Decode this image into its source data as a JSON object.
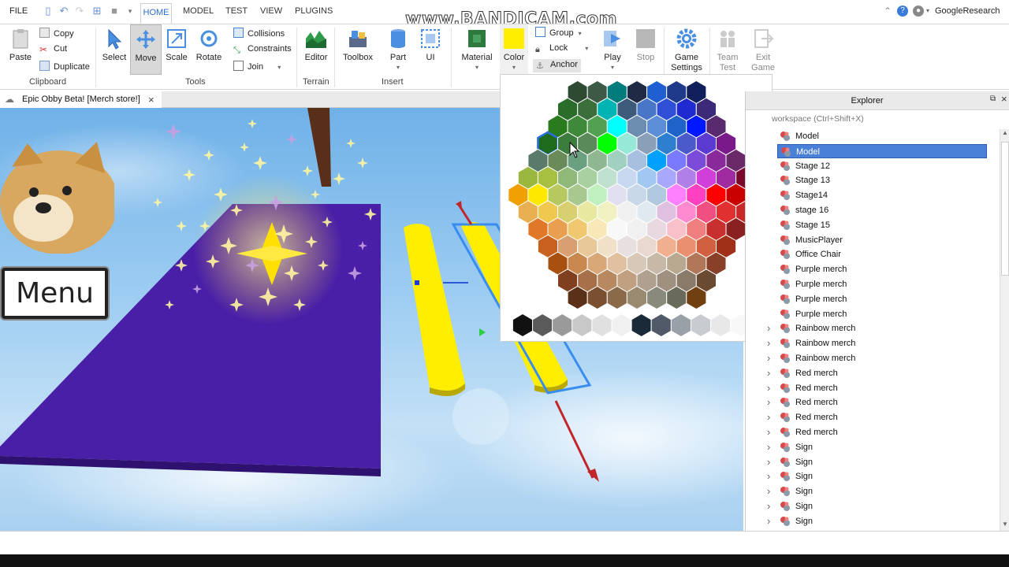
{
  "menu": {
    "file": "FILE",
    "tabs": [
      "HOME",
      "MODEL",
      "TEST",
      "VIEW",
      "PLUGINS"
    ],
    "watermark": "www.BANDICAM.com",
    "user": "GoogleResearch"
  },
  "ribbon": {
    "clipboard": {
      "paste": "Paste",
      "copy": "Copy",
      "cut": "Cut",
      "duplicate": "Duplicate",
      "label": "Clipboard"
    },
    "tools": {
      "select": "Select",
      "move": "Move",
      "scale": "Scale",
      "rotate": "Rotate",
      "collisions": "Collisions",
      "constraints": "Constraints",
      "join": "Join",
      "label": "Tools"
    },
    "terrain": {
      "editor": "Editor",
      "label": "Terrain"
    },
    "insert": {
      "toolbox": "Toolbox",
      "part": "Part",
      "ui": "UI",
      "label": "Insert"
    },
    "edit": {
      "material": "Material",
      "color": "Color",
      "group": "Group",
      "lock": "Lock",
      "anchor": "Anchor"
    },
    "test": {
      "play": "Play",
      "stop": "Stop"
    },
    "settings": {
      "game_settings_1": "Game",
      "game_settings_2": "Settings"
    },
    "team_test": {
      "line1": "Team",
      "line2": "Test"
    },
    "exit_game": {
      "line1": "Exit",
      "line2": "Game"
    },
    "accent_color": "#2a6fc9"
  },
  "document_tab": {
    "title": "Epic Obby Beta! [Merch store!]"
  },
  "viewport": {
    "menu_button": "Menu"
  },
  "explorer": {
    "title": "Explorer",
    "filter_placeholder": "workspace (Ctrl+Shift+X)",
    "items": [
      {
        "label": "Model",
        "expandable": false,
        "selected": false
      },
      {
        "label": "Model",
        "expandable": false,
        "selected": true
      },
      {
        "label": "Stage 12",
        "expandable": false,
        "selected": false
      },
      {
        "label": "Stage 13",
        "expandable": false,
        "selected": false
      },
      {
        "label": "Stage14",
        "expandable": false,
        "selected": false
      },
      {
        "label": "stage 16",
        "expandable": false,
        "selected": false
      },
      {
        "label": "Stage 15",
        "expandable": false,
        "selected": false
      },
      {
        "label": "MusicPlayer",
        "expandable": false,
        "selected": false
      },
      {
        "label": "Office Chair",
        "expandable": false,
        "selected": false
      },
      {
        "label": "Purple merch",
        "expandable": false,
        "selected": false
      },
      {
        "label": "Purple merch",
        "expandable": false,
        "selected": false
      },
      {
        "label": "Purple merch",
        "expandable": false,
        "selected": false
      },
      {
        "label": "Purple merch",
        "expandable": false,
        "selected": false
      },
      {
        "label": "Rainbow merch",
        "expandable": true,
        "selected": false
      },
      {
        "label": "Rainbow merch",
        "expandable": true,
        "selected": false
      },
      {
        "label": "Rainbow merch",
        "expandable": true,
        "selected": false
      },
      {
        "label": "Red merch",
        "expandable": true,
        "selected": false
      },
      {
        "label": "Red merch",
        "expandable": true,
        "selected": false
      },
      {
        "label": "Red merch",
        "expandable": true,
        "selected": false
      },
      {
        "label": "Red merch",
        "expandable": true,
        "selected": false
      },
      {
        "label": "Red merch",
        "expandable": true,
        "selected": false
      },
      {
        "label": "Sign",
        "expandable": true,
        "selected": false
      },
      {
        "label": "Sign",
        "expandable": true,
        "selected": false
      },
      {
        "label": "Sign",
        "expandable": true,
        "selected": false
      },
      {
        "label": "Sign",
        "expandable": true,
        "selected": false
      },
      {
        "label": "Sign",
        "expandable": true,
        "selected": false
      },
      {
        "label": "Sign",
        "expandable": true,
        "selected": false
      }
    ]
  },
  "color_picker": {
    "selected_color": "#1e6b1e",
    "palette_rows": [
      [
        "#2f4a32",
        "#3d5a46",
        "#007c7c",
        "#1f2a44",
        "#1f5fd1",
        "#1f3a8a",
        "#10205a"
      ],
      [
        "#2a6d2a",
        "#3b6e3b",
        "#00b4b4",
        "#3e5a7a",
        "#4a76c8",
        "#2e4fd6",
        "#1f2bd0",
        "#3a2a78"
      ],
      [
        "#2a7a1e",
        "#3f8a3a",
        "#52a052",
        "#00ffff",
        "#6c8cb0",
        "#5b8ed6",
        "#1e64c8",
        "#0018ff",
        "#5a2a6e"
      ],
      [
        "#1e6b1e",
        "#3c7c3c",
        "#5a8a5a",
        "#00ff00",
        "#98e8d8",
        "#8a9fb8",
        "#2e7fd0",
        "#4a5acb",
        "#5a3ad0",
        "#7a1a8a"
      ],
      [
        "#5a7a6a",
        "#6a8a5a",
        "#6aa080",
        "#90b890",
        "#a0d0c0",
        "#a8c0e0",
        "#00a0ff",
        "#7a7aff",
        "#7a4ad8",
        "#8a2a9a",
        "#6a2a6a"
      ],
      [
        "#9ab840",
        "#a8c040",
        "#90b878",
        "#a8d0a0",
        "#c0e0d0",
        "#c8d8f0",
        "#a0c8f0",
        "#a8a8ff",
        "#b080e8",
        "#d040d8",
        "#a02aa0",
        "#7a0a2a"
      ],
      [
        "#f0a000",
        "#ffe800",
        "#b8c860",
        "#a8c890",
        "#c0f0c0",
        "#e0e0f0",
        "#c8d8e8",
        "#b0c8e0",
        "#ff80ff",
        "#ff40c0",
        "#ff0000",
        "#c80000",
        "#8a0000"
      ],
      [
        "#e8b050",
        "#f0c850",
        "#d8d070",
        "#e8e8a0",
        "#f0f0c0",
        "#f0f0f0",
        "#e0e8f0",
        "#e0c0e0",
        "#ff8ad0",
        "#f05080",
        "#e03030",
        "#c82828"
      ],
      [
        "#e07828",
        "#e8a050",
        "#f0c870",
        "#f8e8b8",
        "#f8f8f8",
        "#f0f0f0",
        "#e8d8e0",
        "#f8c0c8",
        "#f08080",
        "#c83030",
        "#8a2020"
      ],
      [
        "#c86020",
        "#d8a070",
        "#e8c898",
        "#f0e0c8",
        "#e8e0e0",
        "#e8d8d0",
        "#f0b090",
        "#e89070",
        "#d06040",
        "#a03018"
      ],
      [
        "#a85010",
        "#c88850",
        "#d8a878",
        "#e0c0a0",
        "#d8c8b8",
        "#c8b8a8",
        "#b8a890",
        "#b07858",
        "#884028"
      ],
      [
        "#804020",
        "#a87048",
        "#b88860",
        "#c0a080",
        "#b0a090",
        "#a09080",
        "#8a7a6a",
        "#6a4a30"
      ],
      [
        "#5a3018",
        "#7a5030",
        "#8a6a48",
        "#9a8a70",
        "#8a8a7a",
        "#6a6a5a",
        "#704010"
      ]
    ],
    "grayscale": [
      "#111111",
      "#5a5a5a",
      "#9a9a9a",
      "#c8c8c8",
      "#e0e0e0",
      "#f0f0f0",
      "#1a2a38",
      "#505a68",
      "#9aa0a8",
      "#c8ccd0",
      "#e8e8e8",
      "#f8f8f8"
    ]
  }
}
